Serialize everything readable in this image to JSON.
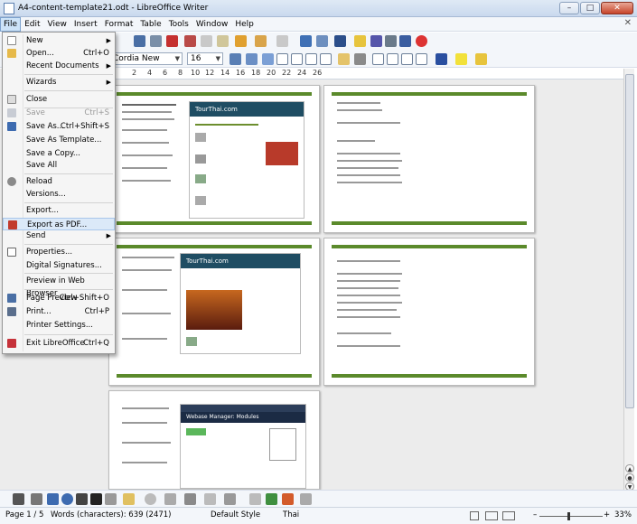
{
  "window": {
    "title": "A4-content-template21.odt - LibreOffice Writer",
    "controls": {
      "minimize": "–",
      "maximize": "□",
      "close": "✕"
    }
  },
  "menubar": {
    "items": [
      "File",
      "Edit",
      "View",
      "Insert",
      "Format",
      "Table",
      "Tools",
      "Window",
      "Help"
    ],
    "close_doc": "✕"
  },
  "format_toolbar": {
    "font_name": "Cordia New",
    "font_size": "16"
  },
  "ruler": {
    "ticks": [
      "2",
      "4",
      "6",
      "8",
      "10",
      "12",
      "14",
      "16",
      "18",
      "20",
      "22",
      "24",
      "26"
    ]
  },
  "file_menu": {
    "items": [
      {
        "label": "New",
        "submenu": true,
        "icon": "new-doc-icon"
      },
      {
        "label": "Open...",
        "shortcut": "Ctrl+O",
        "icon": "open-folder-icon"
      },
      {
        "label": "Recent Documents",
        "submenu": true
      },
      {
        "label": "Wizards",
        "submenu": true
      },
      {
        "label": "Close",
        "icon": "close-doc-icon"
      },
      {
        "label": "Save",
        "shortcut": "Ctrl+S",
        "disabled": true,
        "icon": "save-icon"
      },
      {
        "label": "Save As...",
        "shortcut": "Ctrl+Shift+S",
        "icon": "save-as-icon"
      },
      {
        "label": "Save As Template..."
      },
      {
        "label": "Save a Copy..."
      },
      {
        "label": "Save All"
      },
      {
        "label": "Reload",
        "icon": "reload-icon"
      },
      {
        "label": "Versions..."
      },
      {
        "label": "Export..."
      },
      {
        "label": "Export as PDF...",
        "icon": "pdf-icon",
        "highlighted": true
      },
      {
        "label": "Send",
        "submenu": true
      },
      {
        "label": "Properties...",
        "icon": "properties-icon"
      },
      {
        "label": "Digital Signatures..."
      },
      {
        "label": "Preview in Web Browser"
      },
      {
        "label": "Page Preview",
        "shortcut": "Ctrl+Shift+O",
        "icon": "page-preview-icon"
      },
      {
        "label": "Print...",
        "shortcut": "Ctrl+P",
        "icon": "print-icon"
      },
      {
        "label": "Printer Settings..."
      },
      {
        "label": "Exit LibreOffice",
        "shortcut": "Ctrl+Q",
        "icon": "exit-icon"
      }
    ]
  },
  "pages": {
    "shot_titles": [
      "TourThai.com",
      "TourThai.com"
    ],
    "shot3_title": "Webase Manager: Modules"
  },
  "status": {
    "page": "Page 1 / 5",
    "words": "Words (characters): 639 (2471)",
    "style": "Default Style",
    "language": "Thai",
    "zoom": "33%"
  },
  "colors": {
    "accent_green": "#5b8a2b",
    "site_header": "#1f4d63",
    "highlight": "#dbe9f8"
  }
}
